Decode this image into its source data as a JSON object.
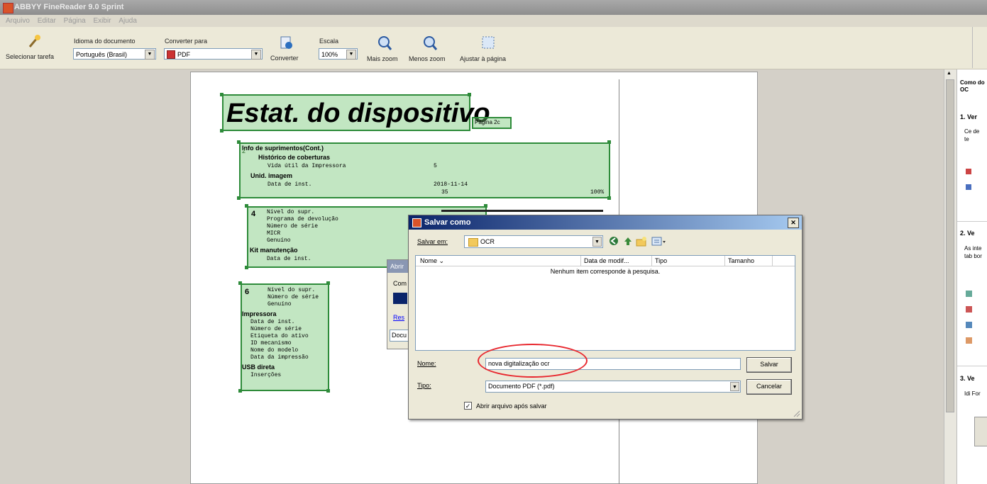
{
  "window": {
    "title": "ABBYY FineReader 9.0 Sprint"
  },
  "menu": [
    "Arquivo",
    "Editar",
    "Página",
    "Exibir",
    "Ajuda"
  ],
  "toolbar": {
    "select_task": "Selecionar tarefa",
    "lang_label": "Idioma do documento",
    "lang_value": "Português (Brasil)",
    "convert_label": "Converter para",
    "convert_value": "PDF",
    "convert_btn": "Converter",
    "scale_label": "Escala",
    "scale_value": "100%",
    "zoom_in": "Mais zoom",
    "zoom_out": "Menos zoom",
    "fit_page": "Ajustar à página"
  },
  "document": {
    "title": "Estat. do dispositivo",
    "page_tag": "Página 2c",
    "zone2": {
      "num": "2",
      "heading": "Info de suprimentos(Cont.)",
      "sub1": "Histórico de coberturas",
      "line1": "Vida útil da Impressora",
      "line1_val": "5",
      "sub2": "Unid. imagem",
      "line2": "Data de inst.",
      "line2_val": "2018-11-14",
      "val_a": "35",
      "val_b": "100%"
    },
    "zone4": {
      "num": "4",
      "lines": [
        "Nível do supr.",
        "Programa de devolução",
        "Número de série",
        "MICR",
        "Genuíno"
      ],
      "sub": "Kit manutenção",
      "last": "Data de inst."
    },
    "zone6": {
      "num": "6",
      "lines_a": [
        "Nível do supr.",
        "Número de série",
        "Genuíno"
      ],
      "sub1": "Impressora",
      "lines_b": [
        "Data de inst.",
        "Número de série",
        "Etiqueta do ativo",
        "ID mecanismo",
        "Nome do modelo",
        "Data da impressão"
      ],
      "sub2": "USB direta",
      "last": "Inserções"
    }
  },
  "bg_dialog": {
    "title": "Abrir",
    "label": "Com",
    "link": "Res",
    "field": "Docu"
  },
  "dialog": {
    "title": "Salvar como",
    "save_in_label": "Salvar em:",
    "save_in_value": "OCR",
    "columns": [
      "Nome",
      "Data de modif...",
      "Tipo",
      "Tamanho"
    ],
    "empty_msg": "Nenhum item corresponde à pesquisa.",
    "name_label": "Nome:",
    "name_value": "nova digitalização ocr",
    "type_label": "Tipo:",
    "type_value": "Documento PDF (*.pdf)",
    "save_btn": "Salvar",
    "cancel_btn": "Cancelar",
    "open_after_label": "Abrir arquivo após salvar",
    "open_after_checked": true
  },
  "right_panel": {
    "heading": "Como do OC",
    "step1": "1. Ver",
    "step1_text": "Ce de te",
    "step2": "2. Ve",
    "step2_text": "As inte tab bor",
    "step3": "3. Ve",
    "step3_text": "Idi For"
  },
  "colors": {
    "zone_border": "#2e8b3a",
    "zone_fill": "#9fd59f",
    "title_bar": "#0a246a",
    "annotation": "#e8272e"
  }
}
